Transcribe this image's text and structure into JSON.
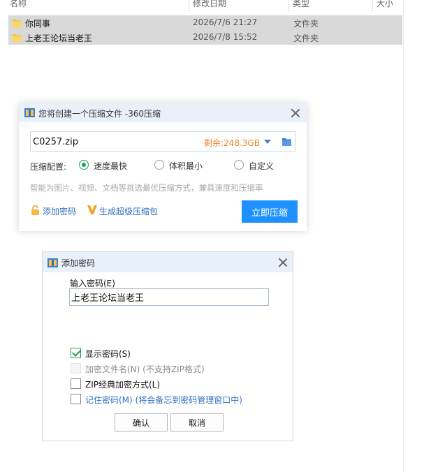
{
  "explorer": {
    "columns": {
      "name": "名称",
      "modified": "修改日期",
      "type": "类型",
      "size": "大小"
    },
    "rows": [
      {
        "name": "你同事",
        "date": "2026/7/6 21:27",
        "type": "文件夹"
      },
      {
        "name": "上老王论坛当老王",
        "date": "2026/7/8 15:52",
        "type": "文件夹"
      }
    ]
  },
  "compress_dialog": {
    "title": "您将创建一个压缩文件 -360压缩",
    "filename": "C0257.zip",
    "free_space": "剩余:248.3GB",
    "config_label": "压缩配置:",
    "options": [
      {
        "label": "速度最快",
        "selected": true
      },
      {
        "label": "体积最小",
        "selected": false
      },
      {
        "label": "自定义",
        "selected": false
      }
    ],
    "hint": "智能为图片、视频、文档等挑选最优压缩方式，兼具速度和压缩率",
    "add_password_link": "添加密码",
    "super_pack_link": "生成超级压缩包",
    "compress_button": "立即压缩"
  },
  "password_dialog": {
    "title": "添加密码",
    "input_label": "输入密码(E)",
    "password_value": "上老王论坛当老王",
    "checkboxes": [
      {
        "label": "显示密码(S)",
        "checked": true,
        "disabled": false
      },
      {
        "label": "加密文件名(N) (不支持ZIP格式)",
        "checked": false,
        "disabled": true
      },
      {
        "label": "ZIP经典加密方式(L)",
        "checked": false,
        "disabled": false
      },
      {
        "label": "记住密码(M) (将会备忘到密码管理窗口中)",
        "checked": false,
        "disabled": false
      }
    ],
    "ok_button": "确认",
    "cancel_button": "取消"
  },
  "colors": {
    "accent_blue": "#1e90ff",
    "free_space_orange": "#e8882a",
    "radio_green": "#1aa260",
    "titlebar_blue": "#e8f0fa",
    "folder_yellow": "#f5c242"
  }
}
